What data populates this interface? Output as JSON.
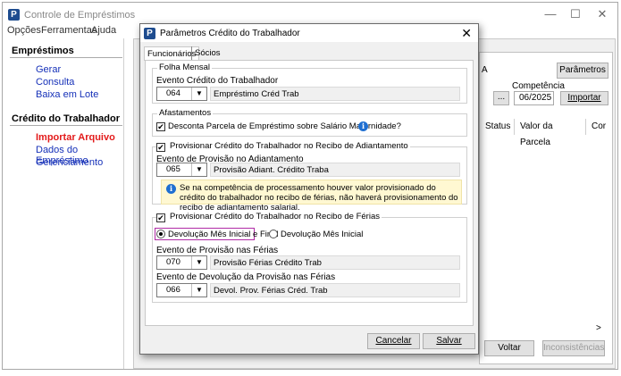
{
  "window": {
    "title": "Controle de Empréstimos",
    "icon_letter": "P"
  },
  "menu": [
    "Opções",
    "Ferramentas",
    "Ajuda"
  ],
  "sidebar": {
    "section1": "Empréstimos",
    "items1": [
      "Gerar",
      "Consulta",
      "Baixa em Lote"
    ],
    "section2": "Crédito do Trabalhador",
    "items2": [
      "Importar Arquivo",
      "Dados do Empréstimo",
      "Gerenciamento"
    ]
  },
  "background": {
    "partial_label": "A",
    "parametros_button": "Parâmetros",
    "competencia_label": "Competência",
    "competencia_value": "06/2025",
    "ellipsis_button": "...",
    "importar_button": "Importar",
    "columns": [
      "Status",
      "Valor da Parcela",
      "Cor"
    ],
    "voltar_button": "Voltar",
    "inconsistencias_button": "Inconsistências",
    "scroll_arrow": ">"
  },
  "dialog": {
    "title": "Parâmetros Crédito do Trabalhador",
    "close": "✕",
    "tabs": [
      "Funcionários",
      "Sócios"
    ],
    "folha": {
      "group_title": "Folha Mensal",
      "label": "Evento Crédito do Trabalhador",
      "code": "064",
      "desc": "Empréstimo Créd Trab"
    },
    "afastamentos": {
      "group_title": "Afastamentos",
      "checkbox_label": "Desconta Parcela de Empréstimo sobre Salário Maternidade?",
      "checked": true
    },
    "adiantamento": {
      "group_title": "Provisionar Crédito do Trabalhador no Recibo de Adiantamento",
      "checked": true,
      "label": "Evento de Provisão no Adiantamento",
      "code": "065",
      "desc": "Provisão Adiant. Crédito Traba",
      "info": "Se na competência de processamento houver valor provisionado do crédito do trabalhador no recibo de férias, não haverá provisionamento do recibo de adiantamento salarial."
    },
    "ferias": {
      "group_title": "Provisionar Crédito do Trabalhador no Recibo de Férias",
      "checked": true,
      "radio1": "Devolução Mês Inicial e Final",
      "radio2": "Devolução Mês Inicial",
      "selected": "radio1",
      "label1": "Evento de Provisão nas Férias",
      "code1": "070",
      "desc1": "Provisão Férias Crédito Trab",
      "label2": "Evento de Devolução da Provisão nas Férias",
      "code2": "066",
      "desc2": "Devol. Prov. Férias Créd. Trab"
    },
    "cancel_button": "Cancelar",
    "save_button": "Salvar"
  },
  "colors": {
    "accent": "#1e4c8f",
    "active_link": "#e31b1b",
    "link": "#1530b8",
    "highlight": "#b02aa6",
    "info_bg": "#fff8d2"
  }
}
